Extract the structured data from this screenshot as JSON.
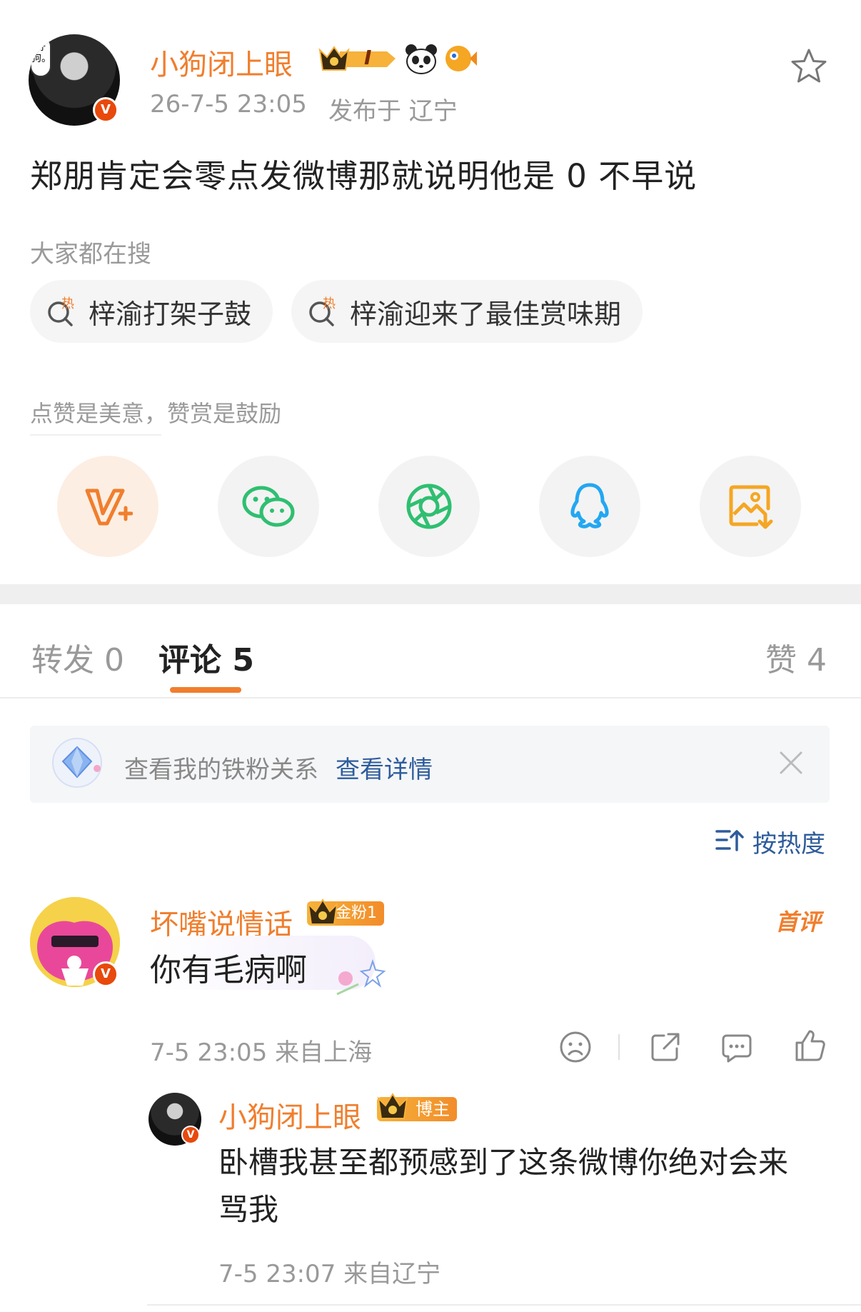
{
  "post": {
    "author": "小狗闭上眼",
    "avatar_bubble_text": "好狗。",
    "level_badge": "I",
    "time": "26-7-5 23:05",
    "location": "发布于 辽宁",
    "text": "郑朋肯定会零点发微博那就说明他是 0 不早说"
  },
  "search": {
    "label": "大家都在搜",
    "pills": [
      "梓渝打架子鼓",
      "梓渝迎来了最佳赏味期"
    ],
    "hot_icon_text": "热"
  },
  "share": {
    "label": "点赞是美意，赞赏是鼓励",
    "buttons": [
      "reward",
      "wechat",
      "moments",
      "qq",
      "save-image"
    ]
  },
  "tabs": {
    "repost": "转发 0",
    "comment": "评论 5",
    "like": "赞 4"
  },
  "fan_bar": {
    "text": "查看我的铁粉关系",
    "link": "查看详情"
  },
  "sort": {
    "label": "按热度"
  },
  "comments": [
    {
      "name": "坏嘴说情话",
      "badge": "金粉1",
      "tag": "首评",
      "text": "你有毛病啊",
      "meta": "7-5 23:05 来自上海",
      "replies": [
        {
          "name": "小狗闭上眼",
          "badge": "博主",
          "text_line1": "卧槽我甚至都预感到了这条微博你绝对会来",
          "text_line2": "骂我",
          "meta": "7-5 23:07 来自辽宁"
        }
      ]
    }
  ],
  "colors": {
    "accent": "#f07e2d",
    "link": "#2e5c9b",
    "wechat": "#2fbf71",
    "qq": "#23a7f2",
    "save": "#f5a623"
  }
}
